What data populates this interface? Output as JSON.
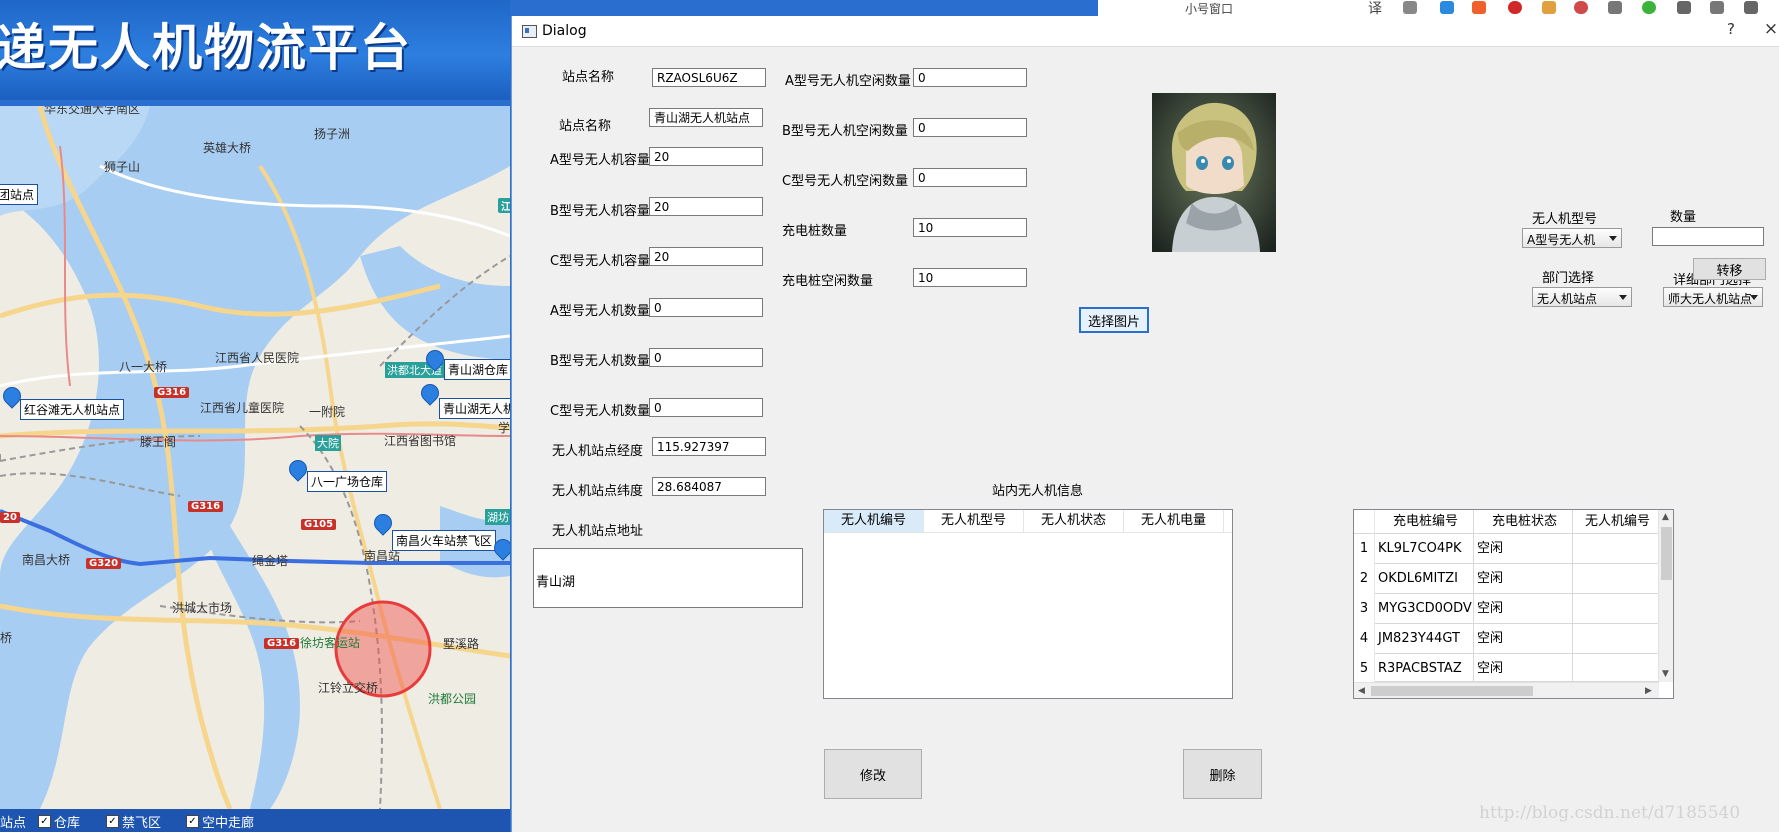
{
  "background_app": {
    "banner_title": "递无人机物流平台",
    "map_places": [
      "华东交通大学南区",
      "扬子洲",
      "英雄大桥",
      "狮子山",
      "八一大桥",
      "江西省人民医院",
      "江西省儿童医院",
      "一附院",
      "滕王阁",
      "大院",
      "江西省图书馆",
      "洪都北大道",
      "八一广场",
      "绳金塔",
      "南昌大桥",
      "洪城大市场",
      "徐坊客运站",
      "江铃立交桥",
      "洪都公园",
      "南昌站",
      "墅溪路",
      "瀛",
      "学",
      "桥",
      "湖坊"
    ],
    "map_tags": [
      "团站点",
      "红谷滩无人机站点",
      "青山湖仓库",
      "青山湖无人机",
      "八一广场仓库",
      "南昌火车站禁飞区"
    ],
    "road_badges": [
      "G316",
      "G316",
      "G105",
      "G320",
      "G316",
      "20",
      "20",
      "江"
    ],
    "layer_checkboxes": [
      {
        "label": "站点",
        "checked": false
      },
      {
        "label": "仓库",
        "checked": true
      },
      {
        "label": "禁飞区",
        "checked": true
      },
      {
        "label": "空中走廊",
        "checked": true
      }
    ],
    "toolbar_text": "小号窗口",
    "toolbar_translate": "译"
  },
  "dialog": {
    "title": "Dialog",
    "help_glyph": "?",
    "close_glyph": "×",
    "left_fields": [
      {
        "label": "站点名称",
        "value": "RZAOSL6U6Z"
      },
      {
        "label": "站点名称",
        "value": "青山湖无人机站点"
      },
      {
        "label": "A型号无人机容量",
        "value": "20"
      },
      {
        "label": "B型号无人机容量",
        "value": "20"
      },
      {
        "label": "C型号无人机容量",
        "value": "20"
      },
      {
        "label": "A型号无人机数量",
        "value": "0"
      },
      {
        "label": "B型号无人机数量",
        "value": "0"
      },
      {
        "label": "C型号无人机数量",
        "value": "0"
      },
      {
        "label": "无人机站点经度",
        "value": "115.927397"
      },
      {
        "label": "无人机站点纬度",
        "value": "28.684087"
      }
    ],
    "address_label": "无人机站点地址",
    "address_value": "青山湖",
    "middle_fields": [
      {
        "label": "A型号无人机空闲数量",
        "value": "0"
      },
      {
        "label": "B型号无人机空闲数量",
        "value": "0"
      },
      {
        "label": "C型号无人机空闲数量",
        "value": "0"
      },
      {
        "label": "充电桩数量",
        "value": "10"
      },
      {
        "label": "充电桩空闲数量",
        "value": "10"
      }
    ],
    "select_image_button": "选择图片",
    "transfer": {
      "drone_model_label": "无人机型号",
      "drone_model_value": "A型号无人机",
      "quantity_label": "数量",
      "quantity_value": "",
      "dept_label": "部门选择",
      "dept_value": "无人机站点",
      "detail_dept_label": "详细部门选择",
      "detail_dept_value": "师大无人机站点",
      "transfer_button": "转移"
    },
    "drone_table": {
      "title": "站内无人机信息",
      "columns": [
        "无人机编号",
        "无人机型号",
        "无人机状态",
        "无人机电量"
      ]
    },
    "charger_table": {
      "columns": [
        "充电桩编号",
        "充电桩状态",
        "无人机编号"
      ],
      "rows": [
        {
          "num": "1",
          "id": "KL9L7CO4PK",
          "status": "空闲",
          "drone": ""
        },
        {
          "num": "2",
          "id": "OKDL6MITZI",
          "status": "空闲",
          "drone": ""
        },
        {
          "num": "3",
          "id": "MYG3CD0ODV",
          "status": "空闲",
          "drone": ""
        },
        {
          "num": "4",
          "id": "JM823Y44GT",
          "status": "空闲",
          "drone": ""
        },
        {
          "num": "5",
          "id": "R3PACBSTAZ",
          "status": "空闲",
          "drone": ""
        }
      ]
    },
    "modify_button": "修改",
    "delete_button": "删除",
    "watermark": "http://blog.csdn.net/d7185540"
  }
}
